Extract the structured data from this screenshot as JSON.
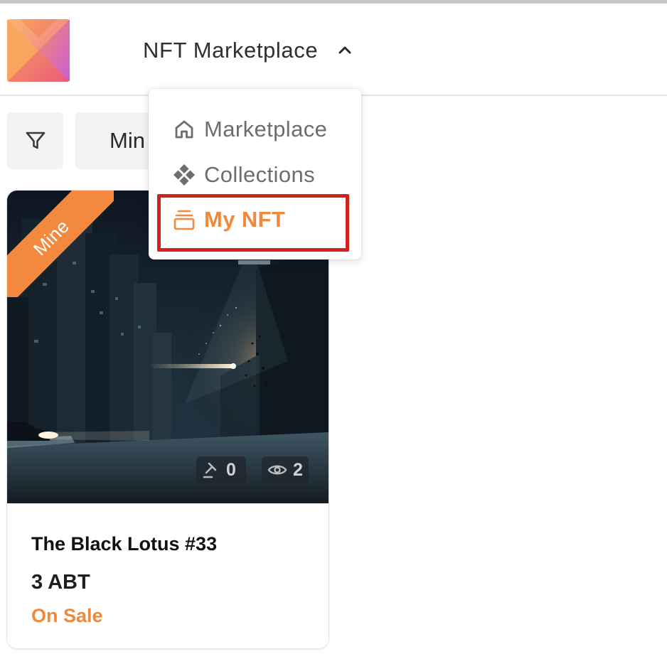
{
  "header": {
    "app_switch_label": "NFT Marketplace",
    "brand_colors": [
      "#f7a35c",
      "#e8557e",
      "#c45bdc"
    ]
  },
  "toolbar": {
    "filter_icon": "filter-icon",
    "sort_select_value": "Min"
  },
  "menu": {
    "items": [
      {
        "label": "Marketplace",
        "icon": "home-icon",
        "active": false
      },
      {
        "label": "Collections",
        "icon": "diamond-grid-icon",
        "active": false
      },
      {
        "label": "My NFT",
        "icon": "stack-icon",
        "active": true
      }
    ],
    "accent_color": "#f0893b",
    "highlight_color": "#d0231c"
  },
  "card": {
    "ribbon_label": "Mine",
    "title": "The Black Lotus #33",
    "price": "3 ABT",
    "status": "On Sale",
    "bids": "0",
    "views": "2",
    "ribbon_color": "#f3893c"
  }
}
